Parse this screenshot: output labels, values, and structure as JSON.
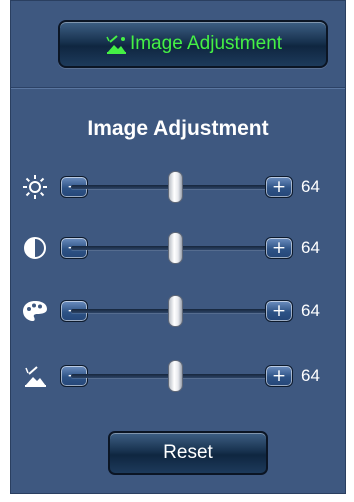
{
  "header_button": {
    "label": "Image Adjustment",
    "icon": "picture-adjust-icon",
    "text_color": "#45f045"
  },
  "panel": {
    "title": "Image Adjustment",
    "background": "#3e5880"
  },
  "sliders": [
    {
      "name": "brightness",
      "icon": "brightness-sun-icon",
      "minus": "−",
      "plus": "+",
      "value": "64",
      "level": 0.5
    },
    {
      "name": "contrast",
      "icon": "contrast-icon",
      "minus": "−",
      "plus": "+",
      "value": "64",
      "level": 0.5
    },
    {
      "name": "saturation",
      "icon": "color-palette-icon",
      "minus": "−",
      "plus": "+",
      "value": "64",
      "level": 0.5
    },
    {
      "name": "sharpness",
      "icon": "sharpness-icon",
      "minus": "−",
      "plus": "+",
      "value": "64",
      "level": 0.5
    }
  ],
  "reset_button": {
    "label": "Reset"
  }
}
